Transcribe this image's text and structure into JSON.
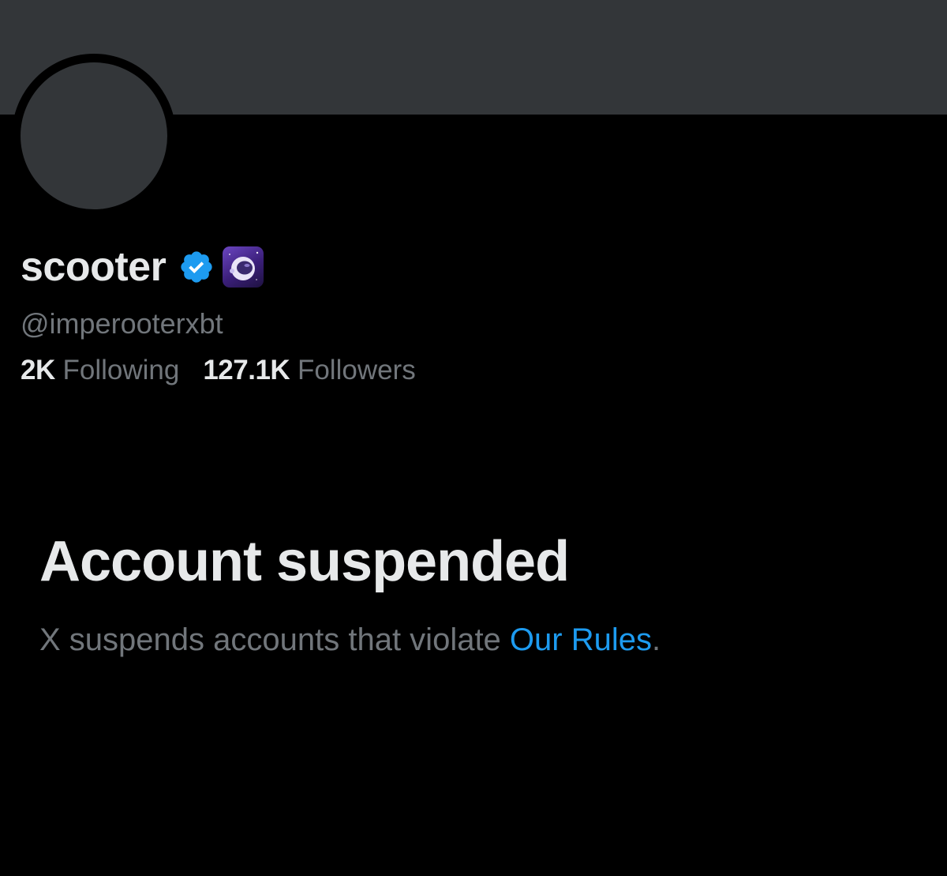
{
  "profile": {
    "display_name": "scooter",
    "handle": "@imperooterxbt",
    "verified_icon": "verified-badge-icon",
    "affiliate_icon": "astronaut-helmet-icon"
  },
  "stats": {
    "following_count": "2K",
    "following_label": "Following",
    "followers_count": "127.1K",
    "followers_label": "Followers"
  },
  "suspension": {
    "title": "Account suspended",
    "message": "X suspends accounts that violate ",
    "link_text": "Our Rules",
    "trailing": "."
  },
  "colors": {
    "background": "#000000",
    "banner": "#333639",
    "primary_text": "#e7e9ea",
    "secondary_text": "#71767b",
    "link": "#1d9bf0",
    "verified": "#1d9bf0"
  }
}
